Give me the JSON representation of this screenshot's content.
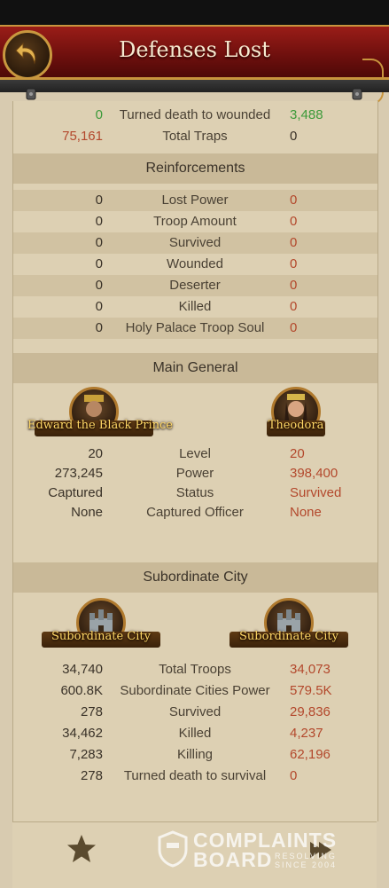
{
  "header": {
    "title": "Defenses Lost"
  },
  "top_rows": [
    {
      "left": "0",
      "label": "Turned death to wounded",
      "right": "3,488"
    },
    {
      "left": "75,161",
      "label": "Total Traps",
      "right": "0"
    }
  ],
  "reinforcements": {
    "title": "Reinforcements",
    "rows": [
      {
        "left": "0",
        "label": "Lost Power",
        "right": "0"
      },
      {
        "left": "0",
        "label": "Troop Amount",
        "right": "0"
      },
      {
        "left": "0",
        "label": "Survived",
        "right": "0"
      },
      {
        "left": "0",
        "label": "Wounded",
        "right": "0"
      },
      {
        "left": "0",
        "label": "Deserter",
        "right": "0"
      },
      {
        "left": "0",
        "label": "Killed",
        "right": "0"
      },
      {
        "left": "0",
        "label": "Holy Palace Troop Soul",
        "right": "0"
      }
    ]
  },
  "main_general": {
    "title": "Main General",
    "left_name": "Edward the Black Prince",
    "right_name": "Theodora",
    "rows": [
      {
        "left": "20",
        "label": "Level",
        "right": "20"
      },
      {
        "left": "273,245",
        "label": "Power",
        "right": "398,400"
      },
      {
        "left": "Captured",
        "label": "Status",
        "right": "Survived"
      },
      {
        "left": "None",
        "label": "Captured Officer",
        "right": "None"
      }
    ]
  },
  "subordinate_city": {
    "title": "Subordinate City",
    "left_name": "Subordinate City",
    "right_name": "Subordinate City",
    "rows": [
      {
        "left": "34,740",
        "label": "Total Troops",
        "right": "34,073"
      },
      {
        "left": "600.8K",
        "label": "Subordinate Cities Power",
        "right": "579.5K"
      },
      {
        "left": "278",
        "label": "Survived",
        "right": "29,836"
      },
      {
        "left": "34,462",
        "label": "Killed",
        "right": "4,237"
      },
      {
        "left": "7,283",
        "label": "Killing",
        "right": "62,196"
      },
      {
        "left": "278",
        "label": "Turned death to survival",
        "right": "0"
      }
    ]
  },
  "watermark": {
    "line1": "COMPLAINTS",
    "line2": "BOARD",
    "tag1": "RESOLVING",
    "tag2": "SINCE 2004"
  },
  "icons": [
    "back-arrow-icon",
    "star-icon",
    "share-icon"
  ]
}
